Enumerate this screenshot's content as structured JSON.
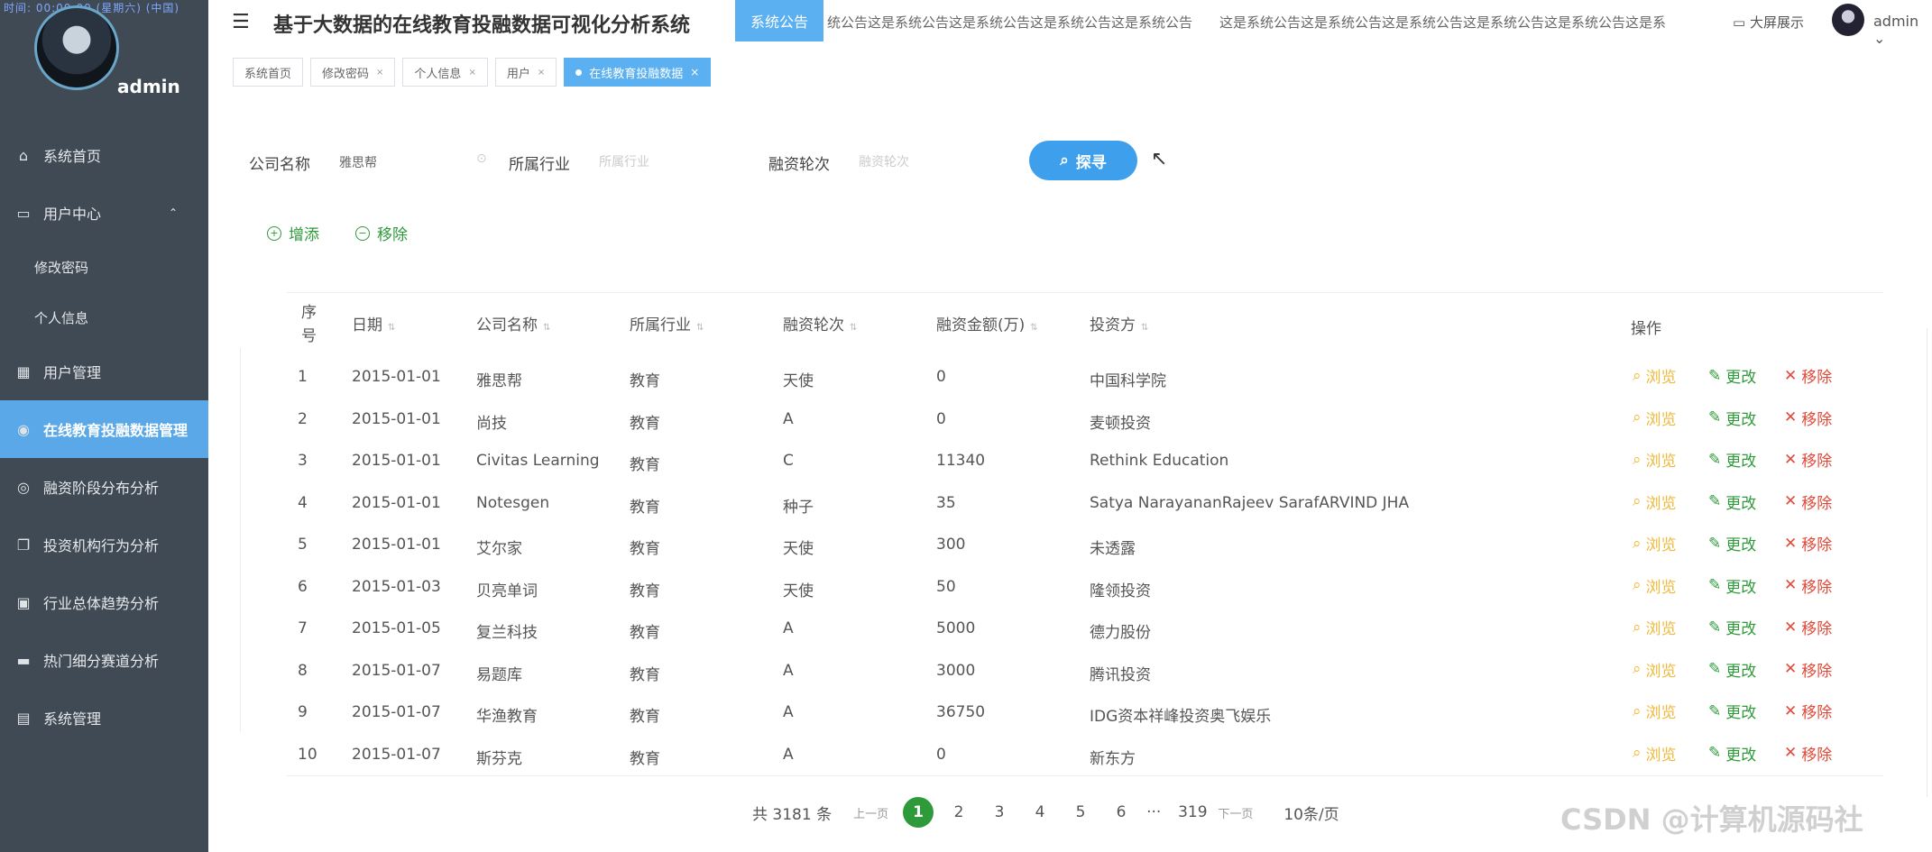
{
  "sidebar": {
    "clock": "时间: 00:00:00 (星期六) (中国)",
    "username": "admin",
    "items": [
      {
        "label": "系统首页",
        "icon": "home-icon"
      },
      {
        "label": "用户中心",
        "icon": "user-center-icon"
      },
      {
        "label": "修改密码",
        "icon": ""
      },
      {
        "label": "个人信息",
        "icon": ""
      },
      {
        "label": "用户管理",
        "icon": "grid-icon"
      },
      {
        "label": "在线教育投融数据管理",
        "icon": "compass-icon"
      },
      {
        "label": "融资阶段分布分析",
        "icon": "target-icon"
      },
      {
        "label": "投资机构行为分析",
        "icon": "copy-icon"
      },
      {
        "label": "行业总体趋势分析",
        "icon": "clipboard-icon"
      },
      {
        "label": "热门细分赛道分析",
        "icon": "briefcase-icon"
      },
      {
        "label": "系统管理",
        "icon": "chat-icon"
      }
    ]
  },
  "header": {
    "title": "基于大数据的在线教育投融数据可视化分析系统",
    "notice_badge": "系统公告",
    "notice_text": "统公告这是系统公告这是系统公告这是系统公告这是系统公告　　这是系统公告这是系统公告这是系统公告这是系统公告这是系统公告这是系",
    "screen_label": "大屏展示",
    "user": "admin"
  },
  "tabs": [
    {
      "label": "系统首页"
    },
    {
      "label": "修改密码"
    },
    {
      "label": "个人信息"
    },
    {
      "label": "用户"
    },
    {
      "label": "在线教育投融数据"
    }
  ],
  "search": {
    "company_label": "公司名称",
    "company_value": "雅思帮",
    "industry_label": "所属行业",
    "industry_placeholder": "所属行业",
    "round_label": "融资轮次",
    "round_placeholder": "融资轮次",
    "button": "探寻"
  },
  "actions": {
    "add": "增添",
    "remove": "移除"
  },
  "table": {
    "headers": {
      "seq": "序号",
      "date": "日期",
      "company": "公司名称",
      "industry": "所属行业",
      "round": "融资轮次",
      "amount": "融资金额(万)",
      "investor": "投资方",
      "ops": "操作"
    },
    "op_labels": {
      "view": "浏览",
      "edit": "更改",
      "del": "移除"
    },
    "rows": [
      {
        "seq": "1",
        "date": "2015-01-01",
        "company": "雅思帮",
        "industry": "教育",
        "round": "天使",
        "amount": "0",
        "investor": "中国科学院"
      },
      {
        "seq": "2",
        "date": "2015-01-01",
        "company": "尚技",
        "industry": "教育",
        "round": "A",
        "amount": "0",
        "investor": "麦顿投资"
      },
      {
        "seq": "3",
        "date": "2015-01-01",
        "company": "Civitas Learning",
        "industry": "教育",
        "round": "C",
        "amount": "11340",
        "investor": "Rethink Education"
      },
      {
        "seq": "4",
        "date": "2015-01-01",
        "company": "Notesgen",
        "industry": "教育",
        "round": "种子",
        "amount": "35",
        "investor": "Satya NarayananRajeev SarafARVIND JHA"
      },
      {
        "seq": "5",
        "date": "2015-01-01",
        "company": "艾尔家",
        "industry": "教育",
        "round": "天使",
        "amount": "300",
        "investor": "未透露"
      },
      {
        "seq": "6",
        "date": "2015-01-03",
        "company": "贝亮单词",
        "industry": "教育",
        "round": "天使",
        "amount": "50",
        "investor": "隆领投资"
      },
      {
        "seq": "7",
        "date": "2015-01-05",
        "company": "复兰科技",
        "industry": "教育",
        "round": "A",
        "amount": "5000",
        "investor": "德力股份"
      },
      {
        "seq": "8",
        "date": "2015-01-07",
        "company": "易题库",
        "industry": "教育",
        "round": "A",
        "amount": "3000",
        "investor": "腾讯投资"
      },
      {
        "seq": "9",
        "date": "2015-01-07",
        "company": "华渔教育",
        "industry": "教育",
        "round": "A",
        "amount": "36750",
        "investor": "IDG资本祥峰投资奥飞娱乐"
      },
      {
        "seq": "10",
        "date": "2015-01-07",
        "company": "斯芬克",
        "industry": "教育",
        "round": "A",
        "amount": "0",
        "investor": "新东方"
      }
    ]
  },
  "pagination": {
    "total": "共 3181 条",
    "prev": "上一页",
    "pages": [
      "1",
      "2",
      "3",
      "4",
      "5",
      "6"
    ],
    "more": "···",
    "last": "319",
    "next": "下一页",
    "size": "10条/页"
  },
  "watermark": "CSDN @计算机源码社"
}
